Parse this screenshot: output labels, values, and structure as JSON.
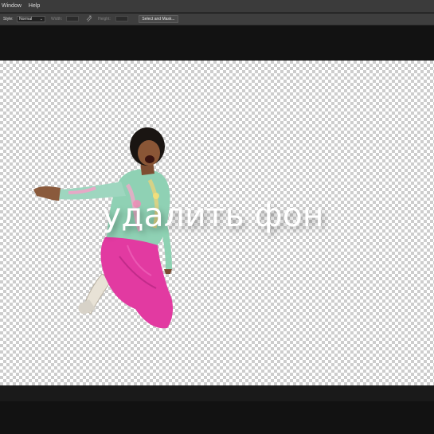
{
  "menubar": {
    "items": [
      "Window",
      "Help"
    ]
  },
  "options": {
    "style_label": "Style:",
    "style_value": "Normal",
    "width_label": "Width:",
    "height_label": "Height:",
    "mask_button": "Select and Mask..."
  },
  "canvas": {
    "overlay_text": "удалить фон"
  },
  "colors": {
    "menubar": "#3b3b3b",
    "options": "#3e3e3e",
    "workspace": "#121212",
    "checker": "#cdcdcd",
    "pants": "#e0359c"
  },
  "icons": [
    "chevron-down-icon",
    "swap-icon"
  ]
}
